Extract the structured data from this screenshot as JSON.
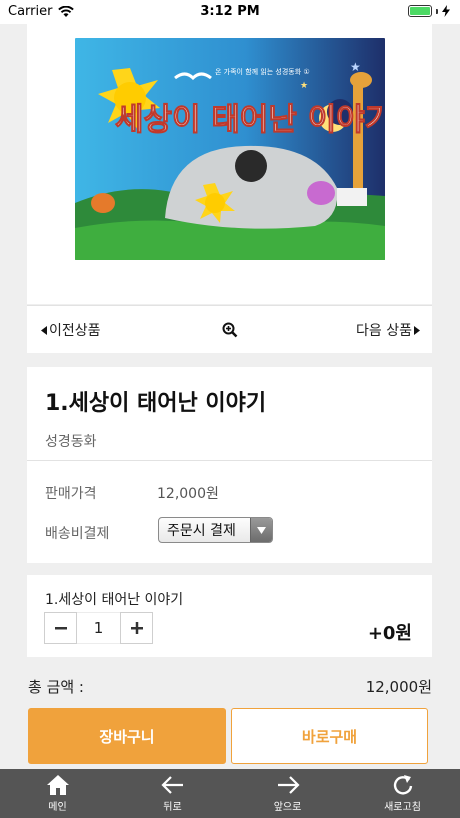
{
  "status_bar": {
    "carrier": "Carrier",
    "time": "3:12 PM"
  },
  "product_image": {
    "series_label": "온 가족이 함께 읽는 성경동화 ①",
    "cover_title": "세상이 태어난 이야기"
  },
  "nav": {
    "prev_label": "이전상품",
    "next_label": "다음 상품"
  },
  "product": {
    "title": "1.세상이 태어난 이야기",
    "category": "성경동화",
    "price_label": "판매가격",
    "price_value": "12,000원",
    "shipping_label": "배송비결제",
    "shipping_selected": "주문시 결제"
  },
  "option": {
    "name": "1.세상이 태어난 이야기",
    "quantity": "1",
    "price": "+0원"
  },
  "total": {
    "label": "총 금액 :",
    "value": "12,000원"
  },
  "actions": {
    "cart_label": "장바구니",
    "buy_label": "바로구매"
  },
  "tab_bar": {
    "items": [
      {
        "label": "메인",
        "icon": "home-icon"
      },
      {
        "label": "뒤로",
        "icon": "arrow-left-icon"
      },
      {
        "label": "앞으로",
        "icon": "arrow-right-icon"
      },
      {
        "label": "새로고침",
        "icon": "refresh-icon"
      }
    ]
  },
  "colors": {
    "accent": "#f0a23c",
    "tab_bar": "#555555",
    "background": "#efefef"
  }
}
